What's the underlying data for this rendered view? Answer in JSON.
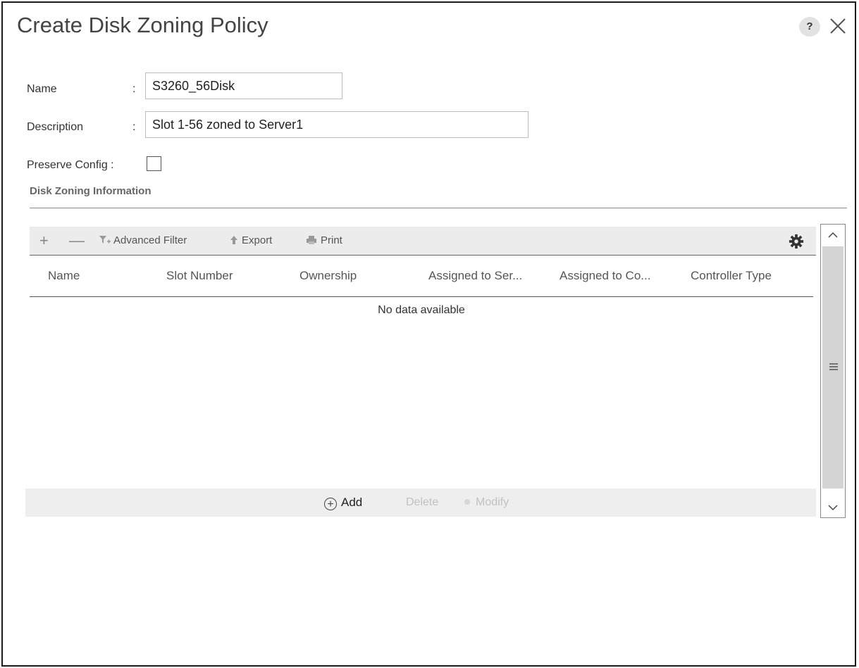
{
  "dialog": {
    "title": "Create Disk Zoning Policy",
    "help_label": "?"
  },
  "form": {
    "name_label": "Name",
    "name_colon": ":",
    "name_value": "S3260_56Disk",
    "description_label": "Description",
    "description_colon": ":",
    "description_value": "Slot 1-56 zoned to Server1",
    "preserve_label": "Preserve Config :",
    "preserve_checked": false
  },
  "section": {
    "title": "Disk Zoning Information"
  },
  "toolbar": {
    "add_glyph": "+",
    "remove_glyph": "—",
    "advanced_filter_label": "Advanced Filter",
    "export_label": "Export",
    "print_label": "Print"
  },
  "table": {
    "columns": [
      "Name",
      "Slot Number",
      "Ownership",
      "Assigned to Ser...",
      "Assigned to Co...",
      "Controller Type"
    ],
    "rows": [],
    "empty_text": "No data available"
  },
  "actions": {
    "add_label": "Add",
    "delete_label": "Delete",
    "modify_label": "Modify"
  }
}
